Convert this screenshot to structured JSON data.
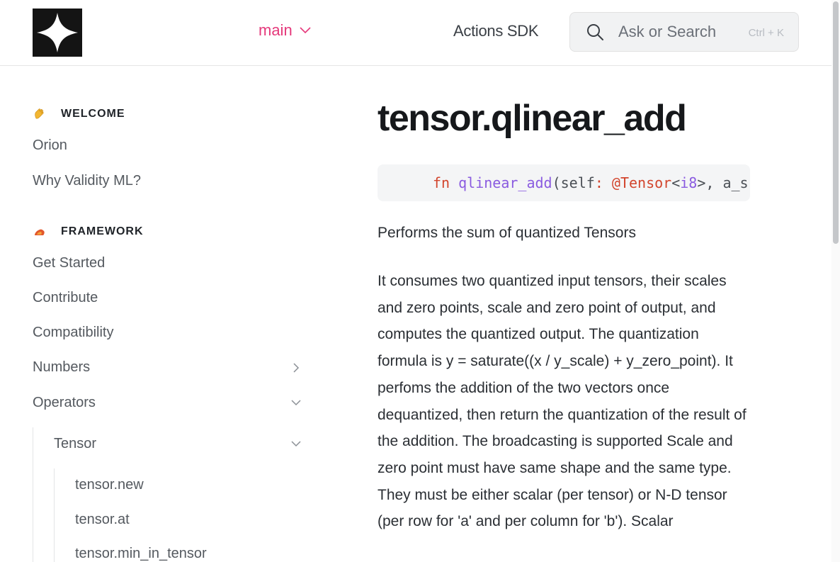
{
  "header": {
    "branch_label": "main",
    "nav_link": "Actions SDK",
    "search": {
      "placeholder": "Ask or Search",
      "shortcut": "Ctrl + K"
    }
  },
  "sidebar": {
    "sections": [
      {
        "emoji": "wave-hand-icon",
        "title": "WELCOME",
        "items": [
          "Orion",
          "Why Validity ML?"
        ]
      },
      {
        "emoji": "fire-icon",
        "title": "FRAMEWORK",
        "items": [
          "Get Started",
          "Contribute",
          "Compatibility",
          "Numbers",
          "Operators"
        ]
      }
    ],
    "operators_children": {
      "label": "Tensor",
      "children": [
        "tensor.new",
        "tensor.at",
        "tensor.min_in_tensor"
      ]
    }
  },
  "main": {
    "title": "tensor.qlinear_add",
    "code": {
      "kw": "fn",
      "fn": "qlinear_add",
      "p1": "(self",
      "colon": ":",
      "type": " @Tensor",
      "lt": "<",
      "gen": "i8",
      "rest": ">, a_s"
    },
    "summary": "Performs the sum of quantized Tensors",
    "description": "It consumes two quantized input tensors, their scales and zero points, scale and zero point of output, and computes the quantized output. The quantization formula is y = saturate((x / y_scale) + y_zero_point). It perfoms the addition of the two vectors once dequantized, then return the quantization of the result of the addition. The broadcasting is supported Scale and zero point must have same shape and the same type. They must be either scalar (per tensor) or N-D tensor (per row for 'a' and per column for 'b'). Scalar"
  },
  "colors": {
    "accent": "#e5397b",
    "text": "#1f2328",
    "muted": "#54595f",
    "code_bg": "#f4f5f6",
    "keyword": "#d2452d",
    "function": "#8a5be0"
  }
}
